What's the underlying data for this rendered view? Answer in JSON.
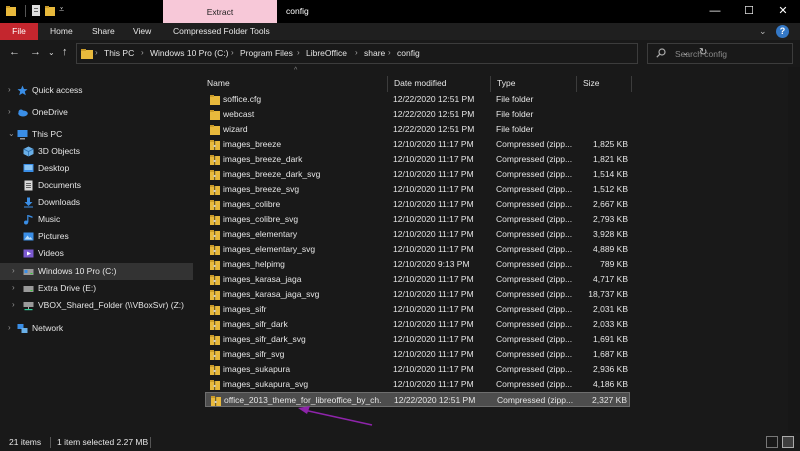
{
  "window": {
    "title": "config",
    "context_tab": "Extract",
    "minimize": "—",
    "maximize": "☐",
    "close": "✕"
  },
  "ribbon": {
    "file": "File",
    "home": "Home",
    "share": "Share",
    "view": "View",
    "compressed_tools": "Compressed Folder Tools",
    "help": "?"
  },
  "address": {
    "breadcrumbs": [
      "This PC",
      "Windows 10 Pro (C:)",
      "Program Files",
      "LibreOffice",
      "share",
      "config"
    ]
  },
  "search": {
    "placeholder": "Search config"
  },
  "nav": {
    "items": [
      {
        "label": "Quick access",
        "icon": "star-icon"
      },
      {
        "label": "OneDrive",
        "icon": "cloud-icon"
      },
      {
        "label": "This PC",
        "icon": "computer-icon"
      },
      {
        "label": "3D Objects",
        "icon": "cube-icon"
      },
      {
        "label": "Desktop",
        "icon": "desktop-icon"
      },
      {
        "label": "Documents",
        "icon": "documents-icon"
      },
      {
        "label": "Downloads",
        "icon": "download-icon"
      },
      {
        "label": "Music",
        "icon": "music-icon"
      },
      {
        "label": "Pictures",
        "icon": "pictures-icon"
      },
      {
        "label": "Videos",
        "icon": "videos-icon"
      },
      {
        "label": "Windows 10 Pro (C:)",
        "icon": "drive-icon"
      },
      {
        "label": "Extra Drive (E:)",
        "icon": "drive-icon"
      },
      {
        "label": "VBOX_Shared_Folder (\\\\VBoxSvr) (Z:)",
        "icon": "network-drive-icon"
      },
      {
        "label": "Network",
        "icon": "network-icon"
      }
    ]
  },
  "columns": {
    "name": "Name",
    "date": "Date modified",
    "type": "Type",
    "size": "Size"
  },
  "files": [
    {
      "name": "soffice.cfg",
      "date": "12/22/2020 12:51 PM",
      "type": "File folder",
      "size": "",
      "kind": "folder"
    },
    {
      "name": "webcast",
      "date": "12/22/2020 12:51 PM",
      "type": "File folder",
      "size": "",
      "kind": "folder"
    },
    {
      "name": "wizard",
      "date": "12/22/2020 12:51 PM",
      "type": "File folder",
      "size": "",
      "kind": "folder"
    },
    {
      "name": "images_breeze",
      "date": "12/10/2020 11:17 PM",
      "type": "Compressed (zipp...",
      "size": "1,825 KB",
      "kind": "zip"
    },
    {
      "name": "images_breeze_dark",
      "date": "12/10/2020 11:17 PM",
      "type": "Compressed (zipp...",
      "size": "1,821 KB",
      "kind": "zip"
    },
    {
      "name": "images_breeze_dark_svg",
      "date": "12/10/2020 11:17 PM",
      "type": "Compressed (zipp...",
      "size": "1,514 KB",
      "kind": "zip"
    },
    {
      "name": "images_breeze_svg",
      "date": "12/10/2020 11:17 PM",
      "type": "Compressed (zipp...",
      "size": "1,512 KB",
      "kind": "zip"
    },
    {
      "name": "images_colibre",
      "date": "12/10/2020 11:17 PM",
      "type": "Compressed (zipp...",
      "size": "2,667 KB",
      "kind": "zip"
    },
    {
      "name": "images_colibre_svg",
      "date": "12/10/2020 11:17 PM",
      "type": "Compressed (zipp...",
      "size": "2,793 KB",
      "kind": "zip"
    },
    {
      "name": "images_elementary",
      "date": "12/10/2020 11:17 PM",
      "type": "Compressed (zipp...",
      "size": "3,928 KB",
      "kind": "zip"
    },
    {
      "name": "images_elementary_svg",
      "date": "12/10/2020 11:17 PM",
      "type": "Compressed (zipp...",
      "size": "4,889 KB",
      "kind": "zip"
    },
    {
      "name": "images_helpimg",
      "date": "12/10/2020 9:13 PM",
      "type": "Compressed (zipp...",
      "size": "789 KB",
      "kind": "zip"
    },
    {
      "name": "images_karasa_jaga",
      "date": "12/10/2020 11:17 PM",
      "type": "Compressed (zipp...",
      "size": "4,717 KB",
      "kind": "zip"
    },
    {
      "name": "images_karasa_jaga_svg",
      "date": "12/10/2020 11:17 PM",
      "type": "Compressed (zipp...",
      "size": "18,737 KB",
      "kind": "zip"
    },
    {
      "name": "images_sifr",
      "date": "12/10/2020 11:17 PM",
      "type": "Compressed (zipp...",
      "size": "2,031 KB",
      "kind": "zip"
    },
    {
      "name": "images_sifr_dark",
      "date": "12/10/2020 11:17 PM",
      "type": "Compressed (zipp...",
      "size": "2,033 KB",
      "kind": "zip"
    },
    {
      "name": "images_sifr_dark_svg",
      "date": "12/10/2020 11:17 PM",
      "type": "Compressed (zipp...",
      "size": "1,691 KB",
      "kind": "zip"
    },
    {
      "name": "images_sifr_svg",
      "date": "12/10/2020 11:17 PM",
      "type": "Compressed (zipp...",
      "size": "1,687 KB",
      "kind": "zip"
    },
    {
      "name": "images_sukapura",
      "date": "12/10/2020 11:17 PM",
      "type": "Compressed (zipp...",
      "size": "2,936 KB",
      "kind": "zip"
    },
    {
      "name": "images_sukapura_svg",
      "date": "12/10/2020 11:17 PM",
      "type": "Compressed (zipp...",
      "size": "4,186 KB",
      "kind": "zip"
    },
    {
      "name": "office_2013_theme_for_libreoffice_by_ch...",
      "date": "12/22/2020 12:51 PM",
      "type": "Compressed (zipp...",
      "size": "2,327 KB",
      "kind": "zip"
    }
  ],
  "status": {
    "items": "21 items",
    "selected": "1 item selected  2.27 MB"
  },
  "colors": {
    "accent_file_tab": "#c4262e",
    "context_tab": "#f7c8d8",
    "annotation_arrow": "#8e24aa",
    "folder": "#e8b93c"
  }
}
